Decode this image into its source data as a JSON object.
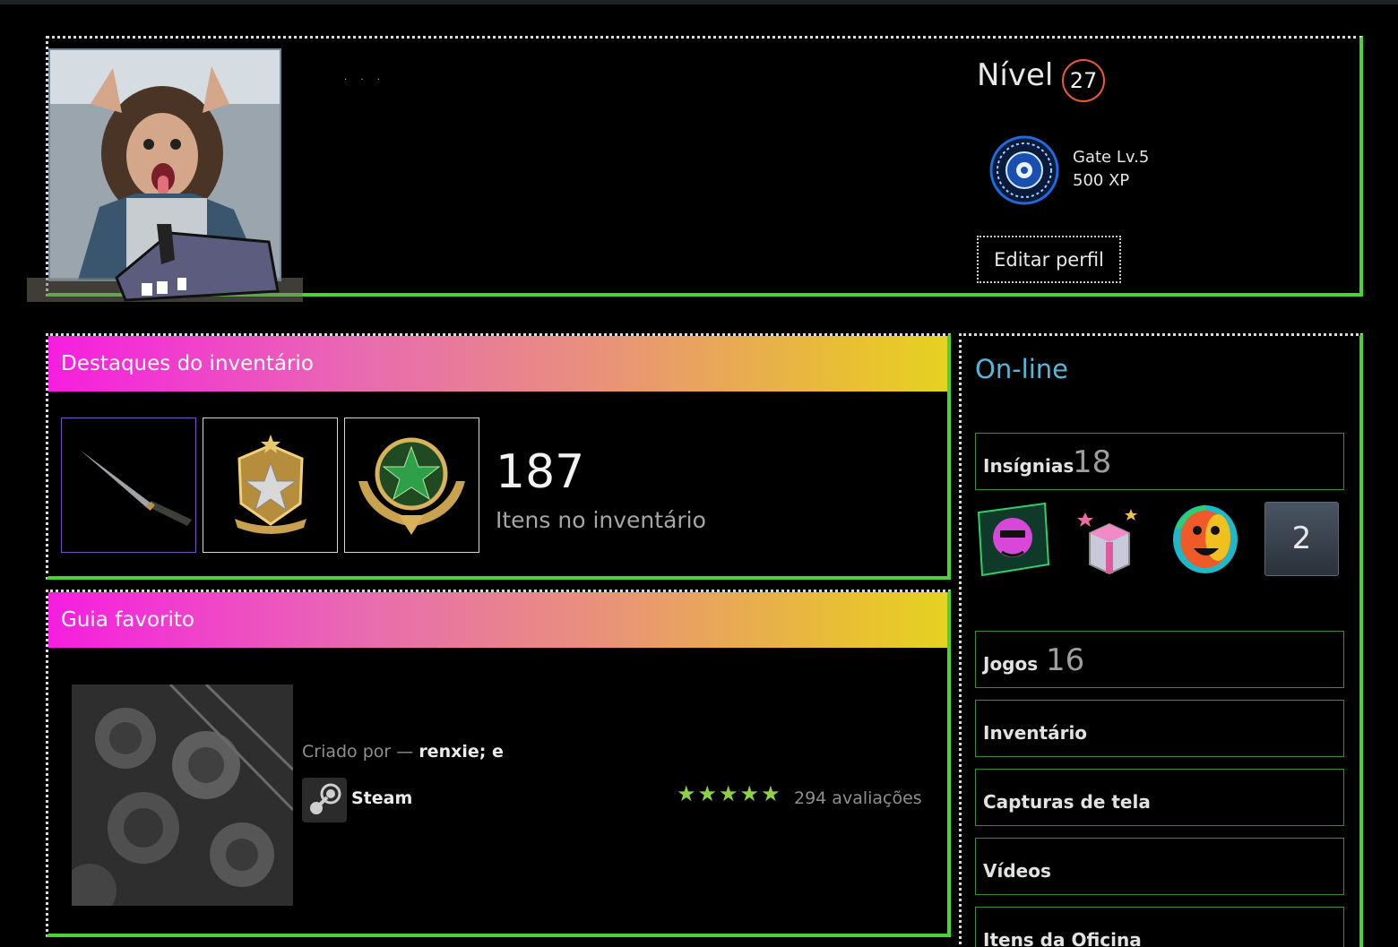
{
  "profile": {
    "name_redacted": "· ·  ·",
    "level_label": "Nível",
    "level": "27",
    "xp_badge": {
      "title": "Gate Lv.5",
      "xp": "500 XP",
      "icon": "gate-badge-icon"
    },
    "edit_button": "Editar perfil"
  },
  "inventory_showcase": {
    "title": "Destaques do inventário",
    "items": [
      {
        "icon": "knife-icon"
      },
      {
        "icon": "star-shield-medal-icon"
      },
      {
        "icon": "green-star-medal-icon"
      }
    ],
    "count": "187",
    "count_label": "Itens no inventário"
  },
  "favorite_guide": {
    "title": "Guia favorito",
    "created_by": "Criado por —",
    "author": "renxie; e",
    "app": "Steam",
    "stars": "★★★★★",
    "reviews": "294 avaliações"
  },
  "sidebar": {
    "status": "On-line",
    "badges": {
      "label": "Insígnias",
      "count": "18",
      "more": "2"
    },
    "games": {
      "label": "Jogos",
      "count": "16"
    },
    "links": [
      "Inventário",
      "Capturas de tela",
      "Vídeos",
      "Itens da Oficina"
    ]
  },
  "colors": {
    "accent_green": "#4cd137",
    "header_gradient_start": "#f61ee0",
    "header_gradient_end": "#e6d222",
    "status_online": "#57b7d9",
    "level_ring": "#e8593c",
    "star_green": "#8ed04a"
  }
}
